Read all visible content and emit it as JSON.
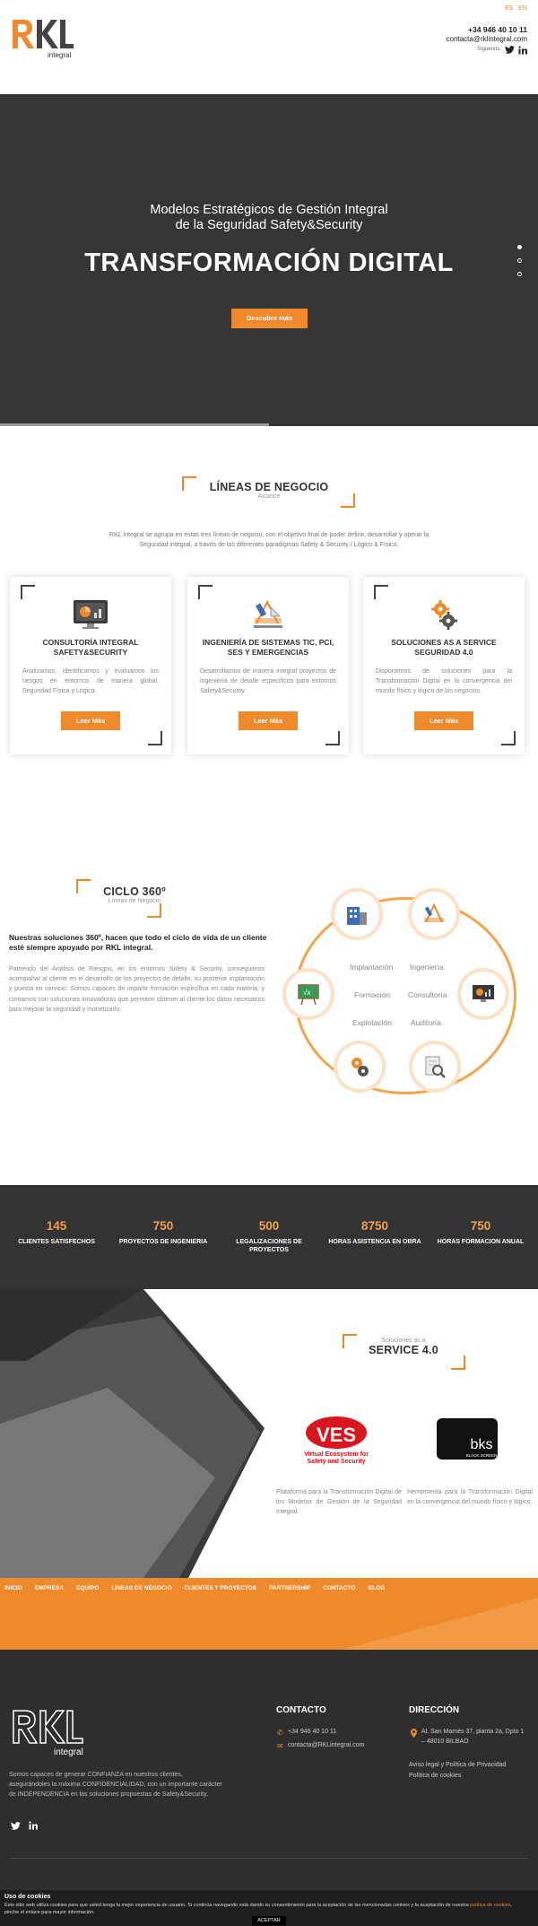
{
  "header": {
    "logo_text": "RKL",
    "logo_sub": "integral",
    "lang_es": "ES",
    "lang_en": "EN",
    "phone": "+34 946 40 10 11",
    "email": "contacta@rklintegral.com",
    "follow_label": "Síguenos:"
  },
  "hero": {
    "subtitle_line1": "Modelos Estratégicos de Gestión Integral",
    "subtitle_line2": "de la Seguridad Safety&Security",
    "title": "TRANSFORMACIÓN DIGITAL",
    "button": "Descubre más"
  },
  "lineas": {
    "title": "LÍNEAS DE NEGOCIO",
    "sub": "Alcance",
    "intro": "RKL Integral se agrupa en estas tres líneas de negocio, con el objetivo final de poder definir, desarrollar y operar la Seguridad integral, a través de los diferentes paradigmas Safety & Security / Lógico & Físico.",
    "cards": [
      {
        "title": "CONSULTORÍA INTEGRAL SAFETY&SECURITY",
        "text": "Analizamos, identificamos y evaluamos los riesgos en entornos de manera global. Seguridad Física y Lógica.",
        "button": "Leer Más",
        "icon": "monitor-chart-icon"
      },
      {
        "title": "INGENIERÍA DE SISTEMAS TIC, PCI, SES Y EMERGENCIAS",
        "text": "Desarrollamos de manera integral proyectos de ingeniería de detalle específicos para entornos Safety&Security.",
        "button": "Leer Más",
        "icon": "drafting-tools-icon"
      },
      {
        "title": "SOLUCIONES AS A SERVICE SEGURIDAD 4.0",
        "text": "Disponemos de soluciones para la Transformación Digital en la convergencia del mundo físico y lógico de los negocios.",
        "button": "Leer Más",
        "icon": "gears-icon"
      }
    ]
  },
  "ciclo": {
    "title": "CICLO 360º",
    "sub": "Líneas de Negocio",
    "lead": "Nuestras soluciones 360º, hacen que todo el ciclo de vida de un cliente esté siempre apoyado por RKL integral.",
    "text": "Partiendo del Análisis de Riesgos, en los entornos Safety & Security, conseguimos acompañar al cliente en el desarrollo de los proyectos de detalle, su posterior implantación y puesta en servicio. Somos capaces de impartir formación específica en cada materia, y contamos con soluciones innovadoras que permiten obtener al cliente los datos necesarios para mejorar la seguridad y monetizarlo.",
    "labels": [
      "Implantación",
      "Ingeniería",
      "Formación",
      "Consultoría",
      "Explotación",
      "Auditoría"
    ]
  },
  "stats": [
    {
      "num": "145",
      "label": "CLIENTES SATISFECHOS"
    },
    {
      "num": "750",
      "label": "PROYECTOS DE INGENIERIA"
    },
    {
      "num": "500",
      "label": "LEGALIZACIONES DE PROYECTOS"
    },
    {
      "num": "8750",
      "label": "HORAS ASISTENCIA EN OBRA"
    },
    {
      "num": "750",
      "label": "HORAS FORMACION ANUAL"
    }
  ],
  "service": {
    "sub": "Soluciones as a",
    "title": "SERVICE 4.0",
    "ves_logo": "VES",
    "ves_tag1": "Virtual Ecosystem for",
    "ves_tag2": "Safety and Security",
    "ves_text": "Plataforma para la Transformación Digital de los Modelos de Gestión de la Seguridad Integral.",
    "bks_logo": "bks",
    "bks_tag": "BLACK SCREEN",
    "bks_text": "Herramienta para la Transformación Digital en la convergencia del mundo físico y lógico."
  },
  "nav": [
    "INICIO",
    "EMPRESA",
    "EQUIPO",
    "LÍNEAS DE NEGOCIO",
    "CLIENTES Y PROYECTOS",
    "PARTNERSHIP",
    "CONTACTO",
    "BLOG"
  ],
  "footer": {
    "logo_text": "RKL",
    "logo_sub": "integral",
    "desc": "Somos capaces de generar CONFIANZA en nuestros clientes, asegurándoles la máxima CONFIDENCIALIDAD, con un importante carácter de INDEPENDENCIA en las soluciones propuestas de Safety&Security.",
    "contact_title": "CONTACTO",
    "phone": "+34 946 40 10 11",
    "email": "contacta@RKLintegral.com",
    "address_title": "DIRECCIÓN",
    "address": "Al. San Mamés 37, planta 2a, Dpto 1 – 48010 BILBAO",
    "legal1": "Aviso legal y Política de Privacidad",
    "legal2": "Política de cookies"
  },
  "cookie": {
    "title": "Uso de cookies",
    "text": "Este sitio web utiliza cookies para que usted tenga la mejor experiencia de usuario. Si continúa navegando está dando su consentimiento para la aceptación de las mencionadas cookies y la aceptación de nuestra ",
    "link": "política de cookies",
    "text2": ", pinche el enlace para mayor información.",
    "button": "ACEPTAR"
  },
  "colors": {
    "accent": "#ee8a2b",
    "dark": "#333333",
    "hero": "#353535"
  }
}
